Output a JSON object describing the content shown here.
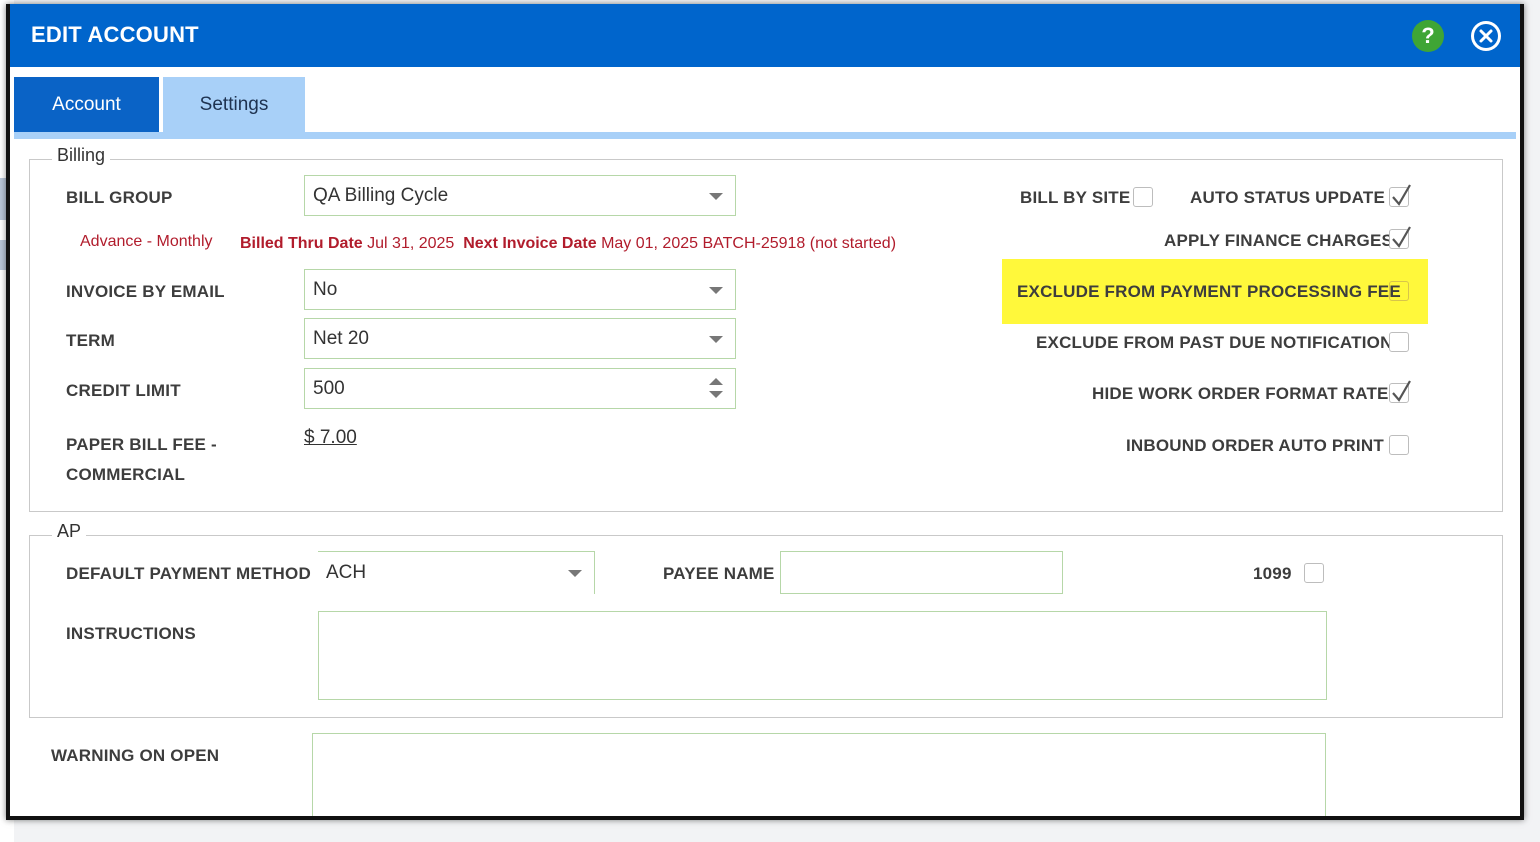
{
  "dialog": {
    "title": "EDIT ACCOUNT",
    "help_label": "?"
  },
  "tabs": [
    {
      "label": "Account",
      "active": false
    },
    {
      "label": "Settings",
      "active": true
    }
  ],
  "billing": {
    "legend": "Billing",
    "bill_group": {
      "label": "BILL GROUP",
      "value": "QA Billing Cycle"
    },
    "billing_type": "Advance - Monthly",
    "billed_thru_label": "Billed Thru Date",
    "billed_thru_value": "Jul 31, 2025",
    "next_invoice_label": "Next Invoice Date",
    "next_invoice_value": "May 01, 2025 BATCH-25918 (not started)",
    "invoice_by_email": {
      "label": "INVOICE BY EMAIL",
      "value": "No"
    },
    "term": {
      "label": "TERM",
      "value": "Net 20"
    },
    "credit_limit": {
      "label": "CREDIT LIMIT",
      "value": "500"
    },
    "paper_bill_fee": {
      "label_line1": "PAPER BILL FEE -",
      "label_line2": "COMMERCIAL",
      "value": "$ 7.00"
    },
    "options": {
      "bill_by_site": {
        "label": "BILL BY SITE",
        "checked": false
      },
      "auto_status_update": {
        "label": "AUTO STATUS UPDATE",
        "checked": true
      },
      "apply_finance_charges": {
        "label": "APPLY FINANCE CHARGES",
        "checked": true
      },
      "exclude_payment_processing_fee": {
        "label": "EXCLUDE FROM PAYMENT PROCESSING FEE",
        "checked": false,
        "highlight_color": "#fff83b"
      },
      "exclude_past_due_notification": {
        "label": "EXCLUDE FROM PAST DUE NOTIFICATION",
        "checked": false
      },
      "hide_work_order_format_rate": {
        "label": "HIDE WORK ORDER FORMAT RATE",
        "checked": true
      },
      "inbound_order_auto_print": {
        "label": "INBOUND ORDER AUTO PRINT",
        "checked": false
      }
    }
  },
  "ap": {
    "legend": "AP",
    "default_payment_method": {
      "label": "DEFAULT PAYMENT METHOD",
      "value": "ACH"
    },
    "payee_name": {
      "label": "PAYEE NAME",
      "value": ""
    },
    "form_1099": {
      "label": "1099",
      "checked": false
    },
    "instructions": {
      "label": "INSTRUCTIONS",
      "value": ""
    }
  },
  "warning_on_open": {
    "label": "WARNING ON OPEN",
    "value": ""
  },
  "colors": {
    "titlebar": "#0065cc",
    "tab_active": "#a8d0f8",
    "tab_inactive": "#0a63c6",
    "alert_red": "#b11c2c",
    "help_green": "#3fa535"
  }
}
